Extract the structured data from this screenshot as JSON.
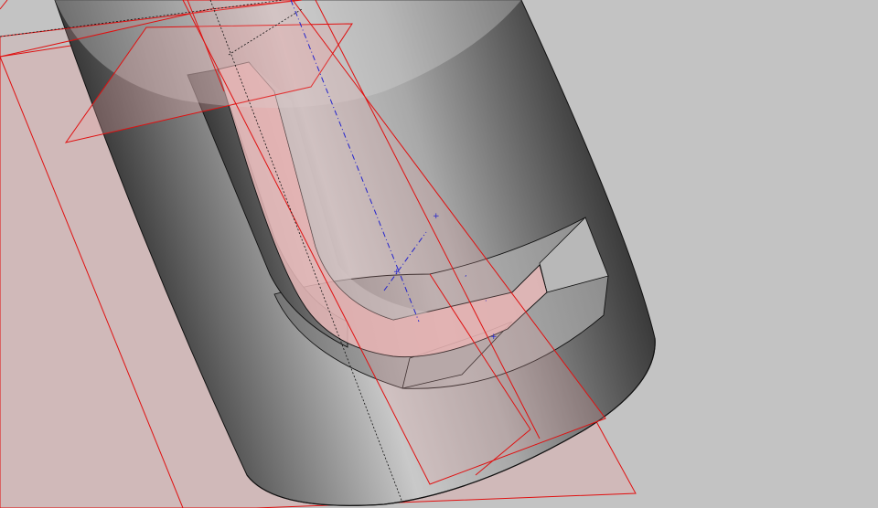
{
  "viewport": {
    "background": "#c3c3c3",
    "body_dark": "#1e1e1e",
    "body_mid": "#8a8a8a",
    "body_light": "#cfcfcf",
    "plane_fill": "#e8a6a6",
    "plane_edge": "#e01010",
    "axis_color": "#2222cc",
    "edge_color": "#111111"
  }
}
